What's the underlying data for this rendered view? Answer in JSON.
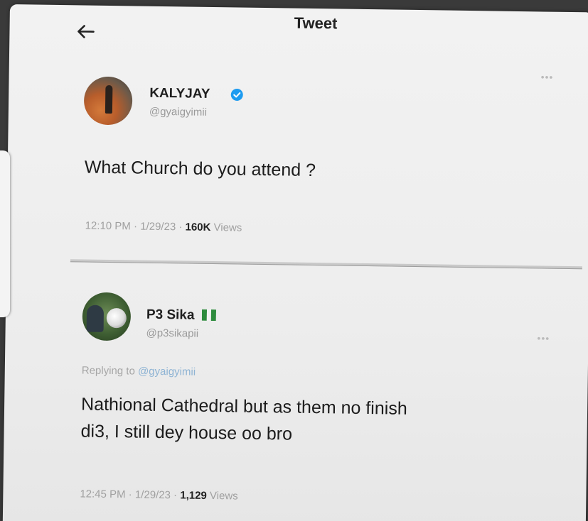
{
  "header": {
    "title": "Tweet"
  },
  "original_tweet": {
    "display_name": "KALYJAY",
    "handle": "@gyaigyimii",
    "text": "What Church do you attend ?",
    "time": "12:10 PM · 1/29/23 · ",
    "views_count": "160K",
    "views_label": " Views"
  },
  "reply_tweet": {
    "display_name": "P3 Sika",
    "handle": "@p3sikapii",
    "replying_to_label": "Replying to ",
    "replying_to_handle": "@gyaigyimii",
    "text_line1": "Nathional Cathedral but as them no finish",
    "text_line2": "di3, I still dey house oo bro",
    "time": "12:45 PM · 1/29/23 · ",
    "views_count": "1,129",
    "views_label": " Views"
  },
  "colors": {
    "verified_badge": "#1d9bf0",
    "flag_green": "#2e8b3d"
  },
  "icons": {
    "back": "arrow-left-icon",
    "verified": "verified-badge-icon",
    "flag": "flag-icon",
    "more": "more-options-icon"
  }
}
